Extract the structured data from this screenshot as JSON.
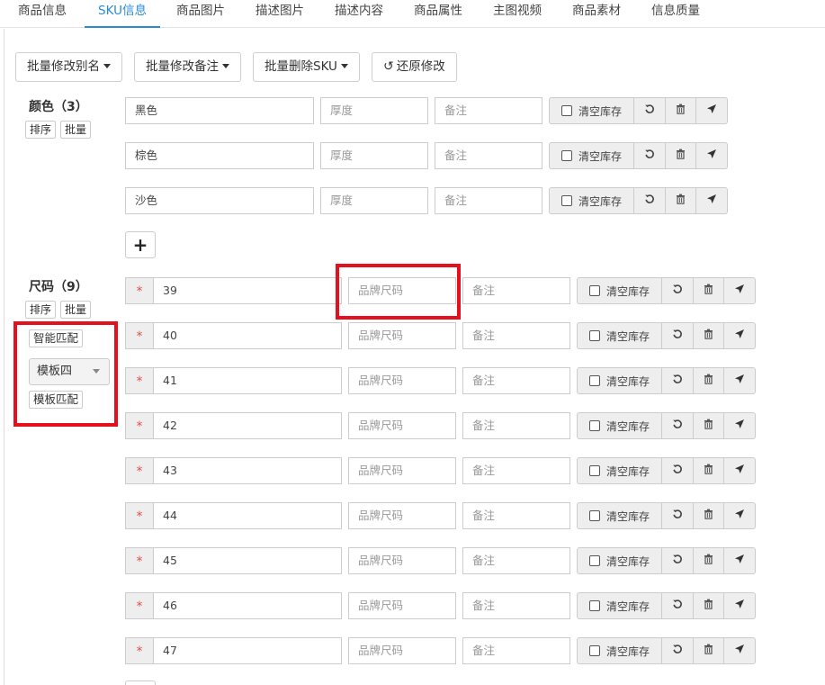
{
  "tabs": [
    "商品信息",
    "SKU信息",
    "商品图片",
    "描述图片",
    "描述内容",
    "商品属性",
    "主图视频",
    "商品素材",
    "信息质量"
  ],
  "active_tab": "SKU信息",
  "toolbar": {
    "batch_alias": "批量修改别名",
    "batch_note": "批量修改备注",
    "batch_delete": "批量删除SKU",
    "restore": "还原修改"
  },
  "color_group": {
    "title": "颜色（3）",
    "sort_label": "排序",
    "batch_label": "批量",
    "rows": [
      {
        "value": "黑色",
        "thickness_placeholder": "厚度",
        "note_placeholder": "备注",
        "clear_label": "清空库存"
      },
      {
        "value": "棕色",
        "thickness_placeholder": "厚度",
        "note_placeholder": "备注",
        "clear_label": "清空库存"
      },
      {
        "value": "沙色",
        "thickness_placeholder": "厚度",
        "note_placeholder": "备注",
        "clear_label": "清空库存"
      }
    ],
    "add_label": "+"
  },
  "size_group": {
    "title": "尺码（9）",
    "sort_label": "排序",
    "batch_label": "批量",
    "smart_match": "智能匹配",
    "template_selected": "模板四",
    "template_match": "模板匹配",
    "required_mark": "*",
    "rows": [
      {
        "value": "39",
        "brand_size_placeholder": "品牌尺码",
        "note_placeholder": "备注",
        "clear_label": "清空库存"
      },
      {
        "value": "40",
        "brand_size_placeholder": "品牌尺码",
        "note_placeholder": "备注",
        "clear_label": "清空库存"
      },
      {
        "value": "41",
        "brand_size_placeholder": "品牌尺码",
        "note_placeholder": "备注",
        "clear_label": "清空库存"
      },
      {
        "value": "42",
        "brand_size_placeholder": "品牌尺码",
        "note_placeholder": "备注",
        "clear_label": "清空库存"
      },
      {
        "value": "43",
        "brand_size_placeholder": "品牌尺码",
        "note_placeholder": "备注",
        "clear_label": "清空库存"
      },
      {
        "value": "44",
        "brand_size_placeholder": "品牌尺码",
        "note_placeholder": "备注",
        "clear_label": "清空库存"
      },
      {
        "value": "45",
        "brand_size_placeholder": "品牌尺码",
        "note_placeholder": "备注",
        "clear_label": "清空库存"
      },
      {
        "value": "46",
        "brand_size_placeholder": "品牌尺码",
        "note_placeholder": "备注",
        "clear_label": "清空库存"
      },
      {
        "value": "47",
        "brand_size_placeholder": "品牌尺码",
        "note_placeholder": "备注",
        "clear_label": "清空库存"
      }
    ]
  },
  "colors": {
    "accent": "#2a8bd5",
    "highlight": "#e5101d",
    "required": "#d9534f"
  }
}
